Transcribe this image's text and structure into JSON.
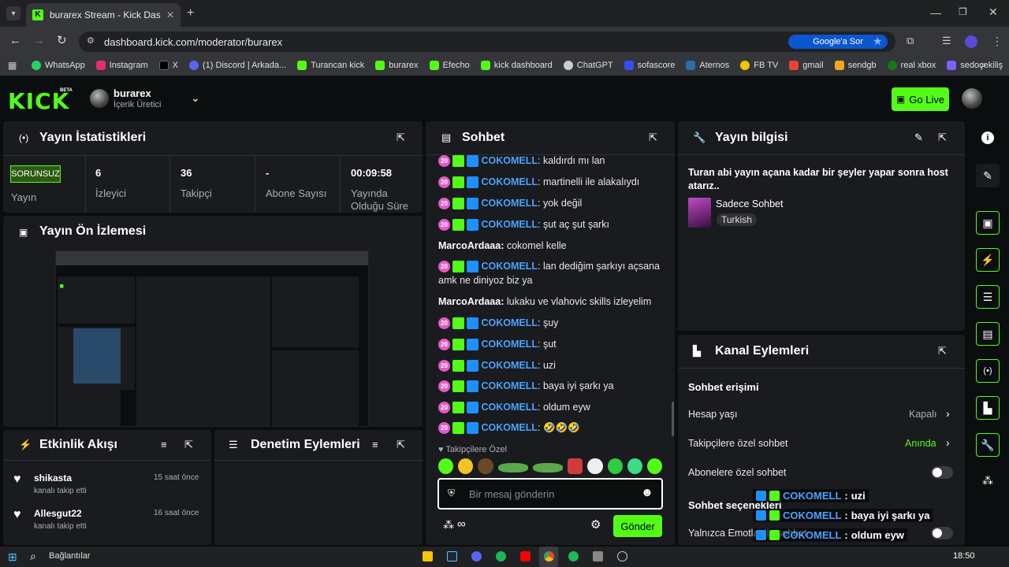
{
  "browser": {
    "tab_title": "burarex Stream - Kick Dashboard",
    "new_tab": "+",
    "url": "dashboard.kick.com/moderator/burarex",
    "google_button": "Google'a Sor",
    "bookmarks": [
      {
        "label": "WhatsApp",
        "color": "#25d366"
      },
      {
        "label": "Instagram",
        "color": "#e1306c"
      },
      {
        "label": "X",
        "color": "#000000"
      },
      {
        "label": "(1) Discord | Arkada...",
        "color": "#5865f2"
      },
      {
        "label": "Turancan kick",
        "color": "#53fc18"
      },
      {
        "label": "burarex",
        "color": "#53fc18"
      },
      {
        "label": "Efecho",
        "color": "#53fc18"
      },
      {
        "label": "kick dashboard",
        "color": "#53fc18"
      },
      {
        "label": "ChatGPT",
        "color": "#cccccc"
      },
      {
        "label": "sofascore",
        "color": "#374df5"
      },
      {
        "label": "Aternos",
        "color": "#2b6cb0"
      },
      {
        "label": "FB TV",
        "color": "#f5c400"
      },
      {
        "label": "gmail",
        "color": "#ea4335"
      },
      {
        "label": "sendgb",
        "color": "#f5a623"
      },
      {
        "label": "real xbox",
        "color": "#107c10"
      },
      {
        "label": "sedoçekiliş",
        "color": "#7b61ff"
      }
    ]
  },
  "header": {
    "logo": "KICK",
    "beta": "BETA",
    "username": "burarex",
    "role": "İçerik Üretici",
    "go_live": "Go Live"
  },
  "stats": {
    "title": "Yayın İstatistikleri",
    "status_badge": "SORUNSUZ",
    "status_label": "Yayın",
    "viewers_value": "6",
    "viewers_label": "İzleyici",
    "followers_value": "36",
    "followers_label": "Takipçi",
    "subs_value": "-",
    "subs_label": "Abone Sayısı",
    "duration_value": "00:09:58",
    "duration_label": "Yayında Olduğu Süre"
  },
  "preview": {
    "title": "Yayın Ön İzlemesi"
  },
  "activity": {
    "title": "Etkinlik Akışı",
    "items": [
      {
        "user": "shikasta",
        "action": "kanalı takip etti",
        "time": "15 saat önce"
      },
      {
        "user": "Allesgut22",
        "action": "kanalı takip etti",
        "time": "16 saat önce"
      }
    ]
  },
  "moderation": {
    "title": "Denetim Eylemleri"
  },
  "chat": {
    "title": "Sohbet",
    "messages": [
      {
        "user": "COKOMELL",
        "text": "kaldırdı mı lan",
        "badges": true
      },
      {
        "user": "COKOMELL",
        "text": "martinelli ile alakalıydı",
        "badges": true
      },
      {
        "user": "COKOMELL",
        "text": "yok değil",
        "badges": true
      },
      {
        "user": "COKOMELL",
        "text": "şut aç şut şarkı",
        "badges": true
      },
      {
        "user": "MarcoArdaaa",
        "text": "cokomel kelle",
        "badges": false
      },
      {
        "user": "COKOMELL",
        "text": "lan dediğim şarkıyı açsana amk ne diniyoz biz ya",
        "badges": true
      },
      {
        "user": "MarcoArdaaa",
        "text": "lukaku ve vlahovic skills izleyelim",
        "badges": false
      },
      {
        "user": "COKOMELL",
        "text": "şuy",
        "badges": true
      },
      {
        "user": "COKOMELL",
        "text": "şut",
        "badges": true
      },
      {
        "user": "COKOMELL",
        "text": "uzi",
        "badges": true
      },
      {
        "user": "COKOMELL",
        "text": "baya iyi şarkı ya",
        "badges": true
      },
      {
        "user": "COKOMELL",
        "text": "oldum eyw",
        "badges": true
      },
      {
        "user": "COKOMELL",
        "text": "🤣🤣🤣",
        "badges": true
      }
    ],
    "badge_sub": "20",
    "followers_only": "Takipçilere Özel",
    "input_placeholder": "Bir mesaj gönderin",
    "send_button": "Gönder"
  },
  "stream_info": {
    "title": "Yayın bilgisi",
    "stream_title": "Turan abi yayın açana kadar bir şeyler yapar sonra host atarız..",
    "category": "Sadece Sohbet",
    "language": "Turkish"
  },
  "channel_actions": {
    "title": "Kanal Eylemleri",
    "chat_access": "Sohbet erişimi",
    "rows": [
      {
        "label": "Hesap yaşı",
        "value": "Kapalı"
      },
      {
        "label": "Takipçilere özel sohbet",
        "value": "Anında"
      },
      {
        "label": "Abonelere özel sohbet",
        "value": ""
      }
    ],
    "chat_options": "Sohbet seçenekleri",
    "emote_only": "Yalnızca Emotlar ile sohbet"
  },
  "overlay": [
    {
      "user": "COKOMELL",
      "text": "uzi"
    },
    {
      "user": "COKOMELL",
      "text": "baya iyi şarkı ya"
    },
    {
      "user": "COKOMELL",
      "text": "oldum eyw"
    },
    {
      "user": "COKOMELL",
      "text": "🤣🤣🤣"
    }
  ],
  "taskbar": {
    "search_label": "Bağlantılar",
    "time": "18:50"
  },
  "colors": {
    "accent": "#53fc18",
    "panel": "#191b1f",
    "username_blue": "#4aa3ff"
  }
}
